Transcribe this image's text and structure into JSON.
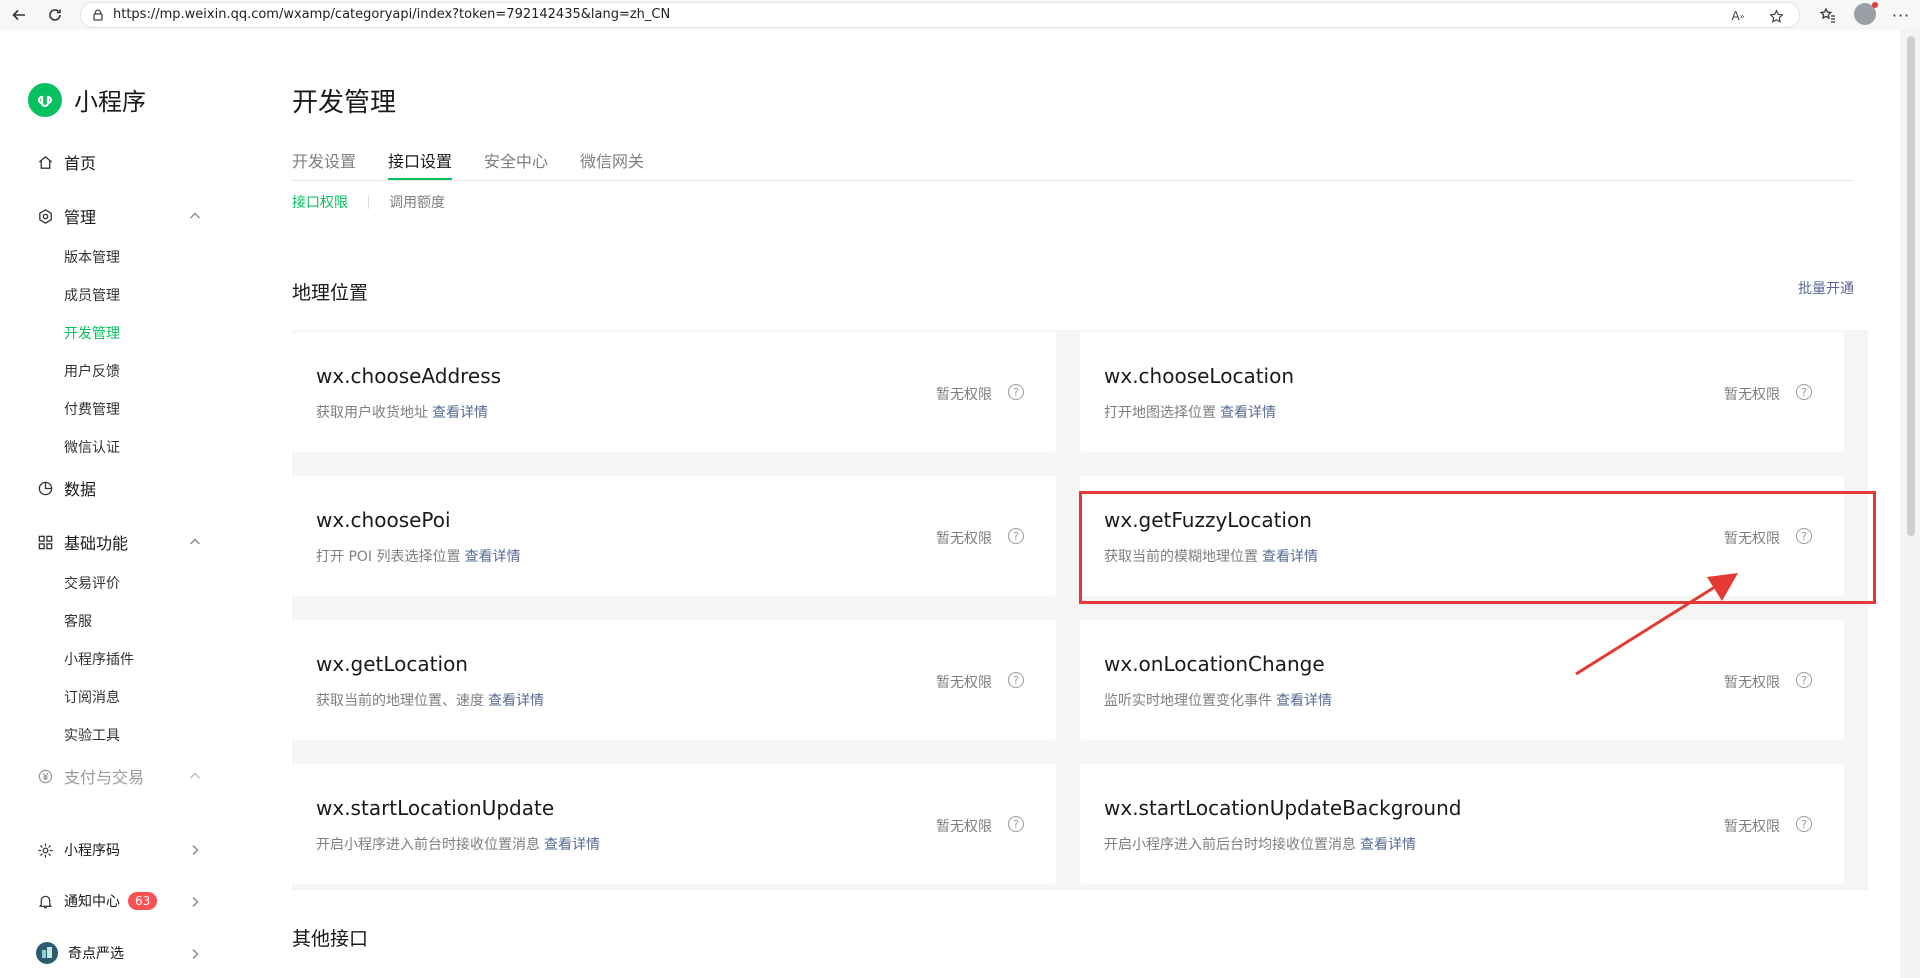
{
  "browser": {
    "url": "https://mp.weixin.qq.com/wxamp/categoryapi/index?token=792142435&lang=zh_CN"
  },
  "sidebar": {
    "brand": "小程序",
    "home": "首页",
    "manage": {
      "label": "管理",
      "items": [
        "版本管理",
        "成员管理",
        "开发管理",
        "用户反馈",
        "付费管理",
        "微信认证"
      ]
    },
    "data": "数据",
    "basic": {
      "label": "基础功能",
      "items": [
        "交易评价",
        "客服",
        "小程序插件",
        "订阅消息",
        "实验工具"
      ]
    },
    "payment": "支付与交易",
    "qrcode": "小程序码",
    "notify": {
      "label": "通知中心",
      "count": "63"
    },
    "account": "奇点严选"
  },
  "main": {
    "title": "开发管理",
    "tabs": [
      "开发设置",
      "接口设置",
      "安全中心",
      "微信网关"
    ],
    "subtabs": [
      "接口权限",
      "调用额度"
    ],
    "section1": "地理位置",
    "bulk": "批量开通",
    "section2": "其他接口",
    "status_text": "暂无权限",
    "detail_link": "查看详情",
    "cards": [
      {
        "api": "wx.chooseAddress",
        "desc": "获取用户收货地址"
      },
      {
        "api": "wx.chooseLocation",
        "desc": "打开地图选择位置"
      },
      {
        "api": "wx.choosePoi",
        "desc": "打开 POI 列表选择位置"
      },
      {
        "api": "wx.getFuzzyLocation",
        "desc": "获取当前的模糊地理位置"
      },
      {
        "api": "wx.getLocation",
        "desc": "获取当前的地理位置、速度"
      },
      {
        "api": "wx.onLocationChange",
        "desc": "监听实时地理位置变化事件"
      },
      {
        "api": "wx.startLocationUpdate",
        "desc": "开启小程序进入前台时接收位置消息"
      },
      {
        "api": "wx.startLocationUpdateBackground",
        "desc": "开启小程序进入前后台时均接收位置消息"
      }
    ]
  },
  "colors": {
    "accent": "#07c160",
    "link": "#576b95",
    "annotation": "#e53935",
    "badge": "#fa5151"
  }
}
